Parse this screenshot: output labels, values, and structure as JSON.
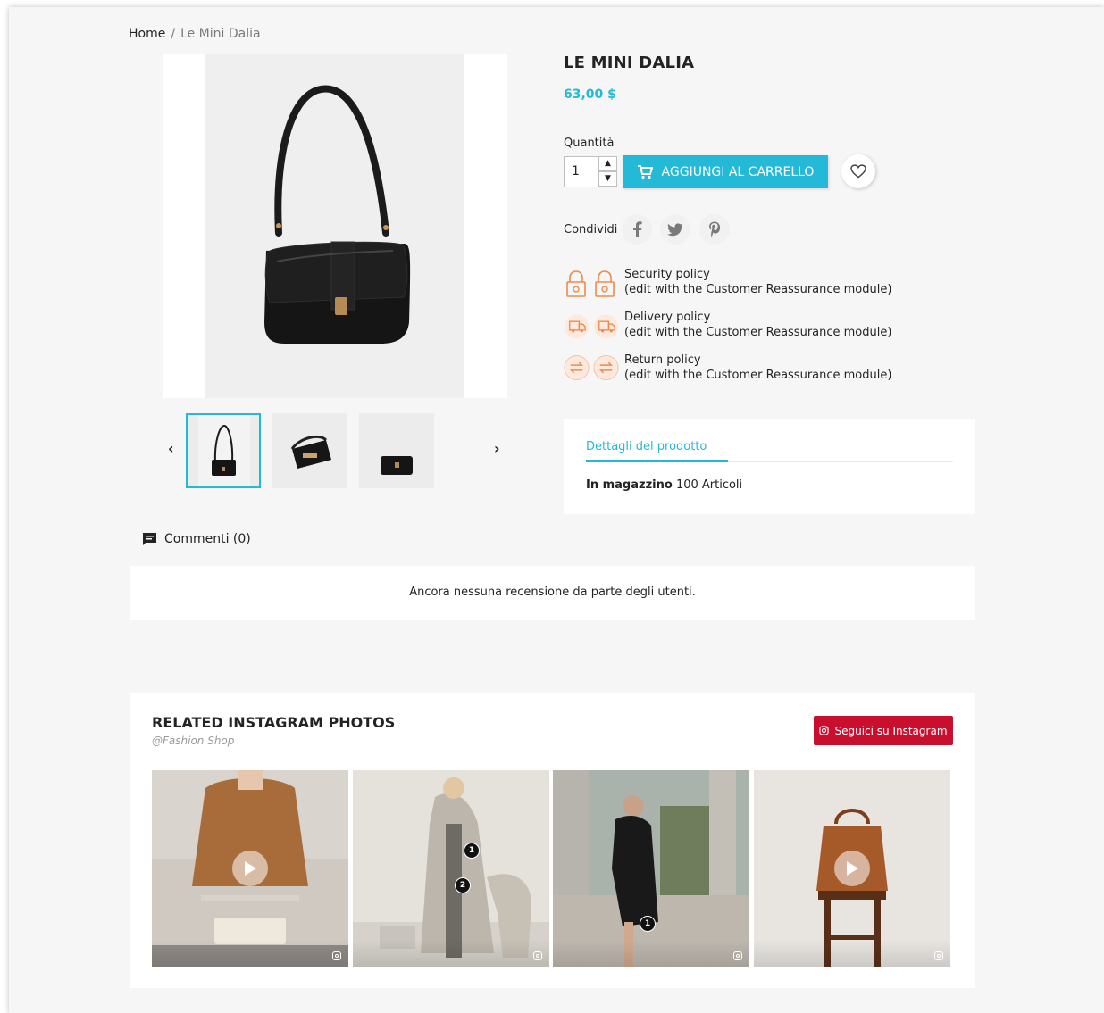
{
  "breadcrumb": {
    "home": "Home",
    "separator": "/",
    "current": "Le Mini Dalia"
  },
  "product": {
    "title": "LE MINI DALIA",
    "price": "63,00 $",
    "quantity_label": "Quantità",
    "quantity_value": "1",
    "add_to_cart_label": "AGGIUNGI AL CARRELLO",
    "share_label": "Condividi"
  },
  "gallery": {
    "thumbnails": [
      "bag-front",
      "bag-open",
      "bag-flat"
    ],
    "selected_index": 0
  },
  "policies": [
    {
      "title": "Security policy",
      "note": "(edit with the Customer Reassurance module)"
    },
    {
      "title": "Delivery policy",
      "note": "(edit with the Customer Reassurance module)"
    },
    {
      "title": "Return policy",
      "note": "(edit with the Customer Reassurance module)"
    }
  ],
  "details": {
    "tab_label": "Dettagli del prodotto",
    "stock_label": "In magazzino",
    "stock_value": "100 Articoli"
  },
  "comments": {
    "header": "Commenti (0)",
    "empty_text": "Ancora nessuna recensione da parte degli utenti."
  },
  "instagram": {
    "title": "RELATED INSTAGRAM PHOTOS",
    "subtitle": "@Fashion Shop",
    "follow_label": "Seguici su Instagram",
    "photos": [
      {
        "has_video": true,
        "pins": []
      },
      {
        "has_video": false,
        "pins": [
          "1",
          "2"
        ]
      },
      {
        "has_video": false,
        "pins": [
          "1"
        ]
      },
      {
        "has_video": true,
        "pins": []
      }
    ]
  },
  "colors": {
    "accent": "#24b9d7",
    "follow_button": "#c8102e",
    "policy_icon": "#f08a4b",
    "page_bg": "#f6f6f6"
  }
}
